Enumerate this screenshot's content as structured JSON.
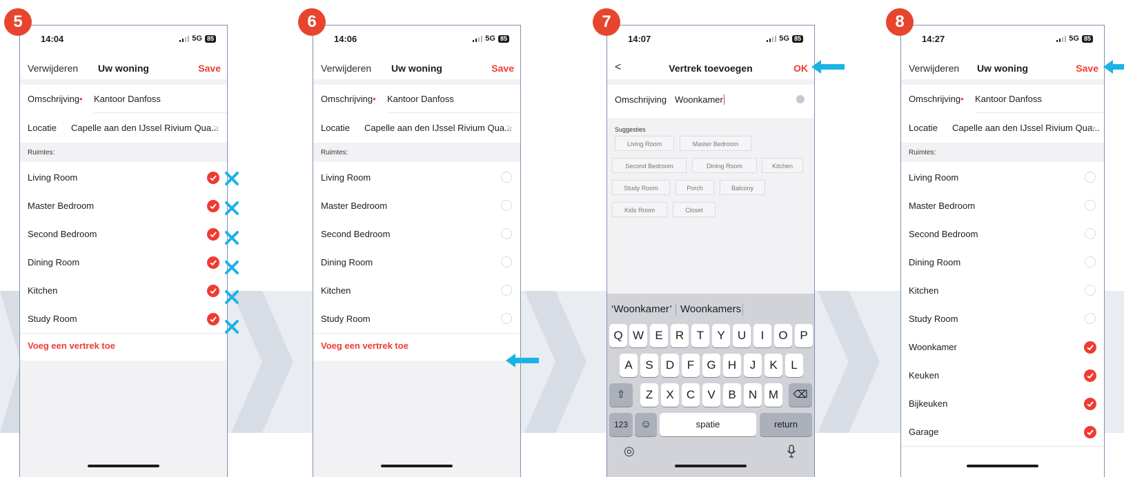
{
  "colors": {
    "accent": "#ef3b32",
    "badge": "#e8452f",
    "annotation": "#1ab3e6"
  },
  "screens": [
    {
      "step": "5",
      "time": "14:04",
      "network": "5G",
      "battery": "85",
      "nav": {
        "left": "Verwijderen",
        "title": "Uw woning",
        "right": "Save"
      },
      "description": {
        "label": "Omschrijving",
        "required": "•",
        "value": "Kantoor Danfoss"
      },
      "location": {
        "label": "Locatie",
        "value": "Capelle aan den IJssel Rivium Qua...",
        "chevron": ">"
      },
      "rooms_header": "Ruimtes:",
      "rooms": [
        {
          "name": "Living Room",
          "selected": true
        },
        {
          "name": "Master Bedroom",
          "selected": true
        },
        {
          "name": "Second Bedroom",
          "selected": true
        },
        {
          "name": "Dining Room",
          "selected": true
        },
        {
          "name": "Kitchen",
          "selected": true
        },
        {
          "name": "Study Room",
          "selected": true
        }
      ],
      "add_link": "Voeg een vertrek toe"
    },
    {
      "step": "6",
      "time": "14:06",
      "network": "5G",
      "battery": "85",
      "nav": {
        "left": "Verwijderen",
        "title": "Uw woning",
        "right": "Save"
      },
      "description": {
        "label": "Omschrijving",
        "required": "•",
        "value": "Kantoor Danfoss"
      },
      "location": {
        "label": "Locatie",
        "value": "Capelle aan den IJssel Rivium Qua...",
        "chevron": ">"
      },
      "rooms_header": "Ruimtes:",
      "rooms": [
        {
          "name": "Living Room",
          "selected": false
        },
        {
          "name": "Master Bedroom",
          "selected": false
        },
        {
          "name": "Second Bedroom",
          "selected": false
        },
        {
          "name": "Dining Room",
          "selected": false
        },
        {
          "name": "Kitchen",
          "selected": false
        },
        {
          "name": "Study Room",
          "selected": false
        }
      ],
      "add_link": "Voeg een vertrek toe"
    },
    {
      "step": "7",
      "time": "14:07",
      "network": "5G",
      "battery": "85",
      "nav": {
        "back": "<",
        "title": "Vertrek toevoegen",
        "right": "OK"
      },
      "field": {
        "label": "Omschrijving",
        "value": "Woonkamer"
      },
      "suggestions_header": "Suggesties",
      "suggestions": [
        "Living Room",
        "Master Bedroom",
        "Second Bedroom",
        "Dining Room",
        "Kitchen",
        "Study Room",
        "Porch",
        "Balcony",
        "Kids Room",
        "Closet"
      ],
      "keyboard": {
        "predictions": [
          "‘Woonkamer’",
          "Woonkamers"
        ],
        "row1": [
          "Q",
          "W",
          "E",
          "R",
          "T",
          "Y",
          "U",
          "I",
          "O",
          "P"
        ],
        "row2": [
          "A",
          "S",
          "D",
          "F",
          "G",
          "H",
          "J",
          "K",
          "L"
        ],
        "row3": [
          "Z",
          "X",
          "C",
          "V",
          "B",
          "N",
          "M"
        ],
        "numbers": "123",
        "space": "spatie",
        "return": "return"
      }
    },
    {
      "step": "8",
      "time": "14:27",
      "network": "5G",
      "battery": "85",
      "nav": {
        "left": "Verwijderen",
        "title": "Uw woning",
        "right": "Save"
      },
      "description": {
        "label": "Omschrijving",
        "required": "•",
        "value": "Kantoor Danfoss"
      },
      "location": {
        "label": "Locatie",
        "value": "Capelle aan den IJssel Rivium Qua...",
        "chevron": ">"
      },
      "rooms_header": "Ruimtes:",
      "rooms": [
        {
          "name": "Living Room",
          "selected": false
        },
        {
          "name": "Master Bedroom",
          "selected": false
        },
        {
          "name": "Second Bedroom",
          "selected": false
        },
        {
          "name": "Dining Room",
          "selected": false
        },
        {
          "name": "Kitchen",
          "selected": false
        },
        {
          "name": "Study Room",
          "selected": false
        },
        {
          "name": "Woonkamer",
          "selected": true
        },
        {
          "name": "Keuken",
          "selected": true
        },
        {
          "name": "Bijkeuken",
          "selected": true
        },
        {
          "name": "Garage",
          "selected": true
        }
      ]
    }
  ]
}
